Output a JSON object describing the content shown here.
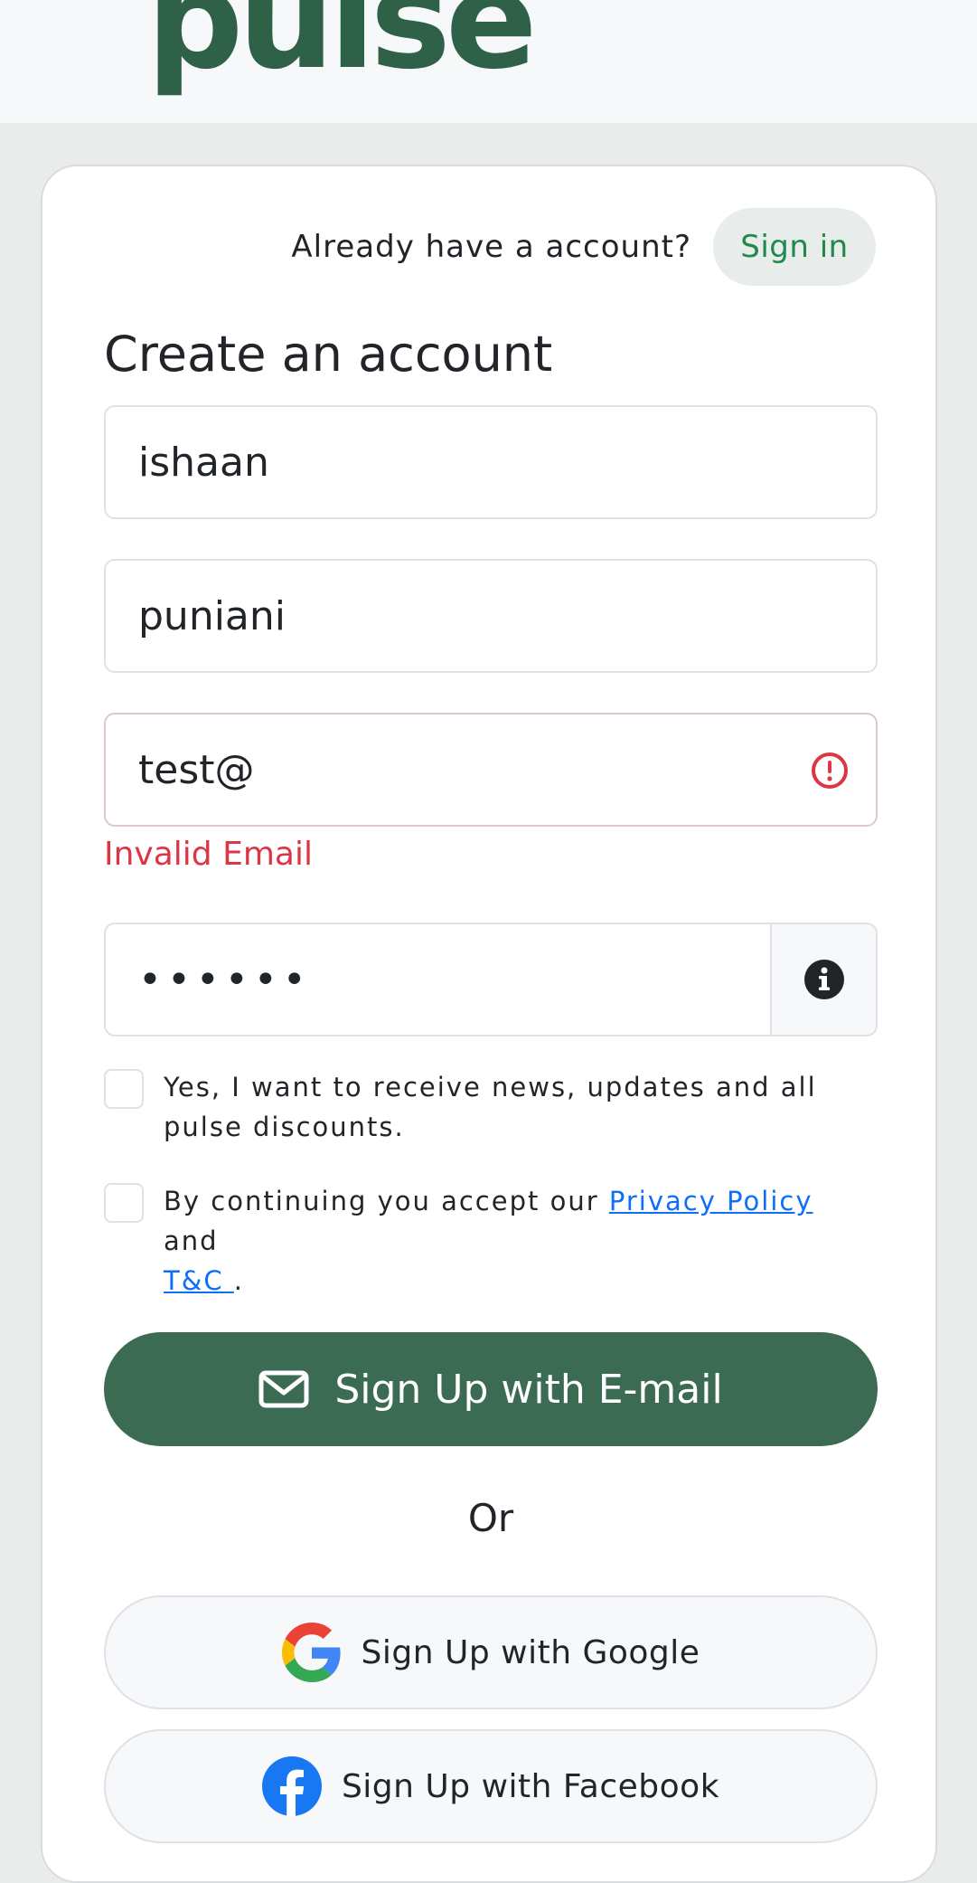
{
  "brand": {
    "logo_text": "pulse",
    "color": "#2e6148"
  },
  "header": {
    "already_text": "Already have a account?",
    "signin_label": "Sign in"
  },
  "form": {
    "title": "Create an account",
    "first_name_value": "ishaan",
    "last_name_value": "puniani",
    "email_value": "test@",
    "email_error": "Invalid Email",
    "password_masked": "••••••",
    "news_consent": "Yes, I want to receive news, updates and all pulse discounts.",
    "terms_prefix": "By continuing you accept our ",
    "privacy_link": "Privacy Policy",
    "terms_and": " and",
    "tc_link": "T&C ",
    "terms_suffix": "."
  },
  "buttons": {
    "email_signup": "Sign Up with E-mail",
    "or": "Or",
    "google_signup": "Sign Up with Google",
    "facebook_signup": "Sign Up with Facebook"
  },
  "colors": {
    "primary": "#3b6b52",
    "error": "#dc3545",
    "link": "#0d6efd",
    "signin_text": "#1f8a4c"
  },
  "icons": [
    "alert-circle-icon",
    "info-icon",
    "envelope-icon",
    "google-icon",
    "facebook-icon"
  ]
}
